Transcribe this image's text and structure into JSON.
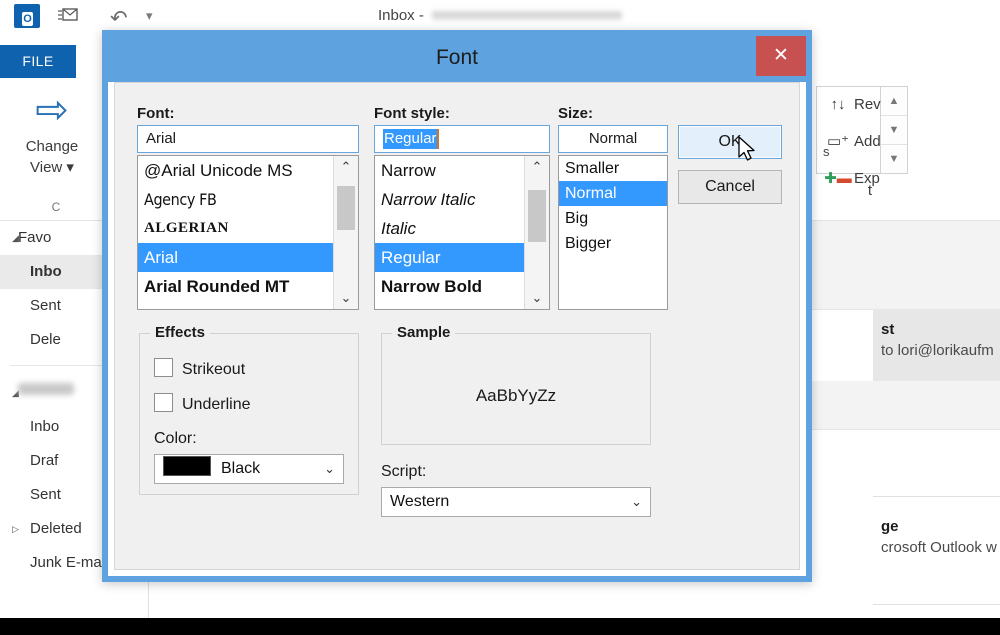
{
  "app": {
    "window_title": "Inbox - ",
    "logo_text": "O",
    "file_tab": "FILE",
    "quick_access": {
      "send_receive_icon": "send-receive-icon",
      "undo_icon": "undo-icon",
      "more_icon": "chevron-down-icon"
    },
    "ribbon": {
      "change_view_label_line1": "Change",
      "change_view_label_line2": "View ▾",
      "group_label": "C",
      "right_items": [
        {
          "icon": "sort-arrows-icon",
          "label": "Rev"
        },
        {
          "icon": "add-columns-icon",
          "label": "Add"
        },
        {
          "icon": "expand-collapse-icon",
          "label": "Exp"
        }
      ],
      "spinner": {
        "up": "▲",
        "down": "▼",
        "bottom": "▼"
      },
      "sort_box_text": "s",
      "loose_text": "t"
    },
    "sidebar": {
      "favorites": {
        "label": "Favo",
        "triangle": "◢"
      },
      "favorite_items": [
        {
          "label": "Inbo",
          "selected": true
        },
        {
          "label": "Sent",
          "selected": false
        },
        {
          "label": "Dele",
          "selected": false
        }
      ],
      "account": {
        "label": "",
        "triangle": "◢",
        "redacted": true
      },
      "account_items": [
        {
          "label": "Inbo",
          "triangle": ""
        },
        {
          "label": "Draf",
          "triangle": ""
        },
        {
          "label": "Sent",
          "triangle": ""
        },
        {
          "label": "Deleted",
          "triangle": "▷"
        },
        {
          "label": "Junk E-mail",
          "triangle": ""
        }
      ]
    },
    "messages": [
      {
        "subject": "st",
        "preview": "to lori@lorikaufm",
        "selected": true
      },
      {
        "subject": "ge",
        "preview": "crosoft Outlook w",
        "selected": false
      }
    ]
  },
  "dialog": {
    "title": "Font",
    "close_label": "✕",
    "font": {
      "label": "Font:",
      "value": "Arial",
      "items": [
        {
          "text": "@Arial Unicode MS",
          "style": "f-unicode",
          "selected": false
        },
        {
          "text": "Agency FB",
          "style": "f-agency",
          "selected": false
        },
        {
          "text": "ALGERIAN",
          "style": "f-algerian",
          "selected": false
        },
        {
          "text": "Arial",
          "style": "f-arial",
          "selected": true
        },
        {
          "text": "Arial Rounded MT",
          "style": "f-arialrnd",
          "selected": false
        }
      ]
    },
    "font_style": {
      "label": "Font style:",
      "value": "Regular",
      "value_selected": true,
      "items": [
        {
          "text": "Narrow",
          "style": "st-narrow",
          "selected": false
        },
        {
          "text": "Narrow Italic",
          "style": "st-narrow st-italic",
          "selected": false
        },
        {
          "text": "Italic",
          "style": "st-italic",
          "selected": false
        },
        {
          "text": "Regular",
          "style": "",
          "selected": true
        },
        {
          "text": "Narrow Bold",
          "style": "st-narrow st-bold",
          "selected": false
        }
      ]
    },
    "size": {
      "label": "Size:",
      "value": "Normal",
      "items": [
        {
          "text": "Smaller",
          "selected": false
        },
        {
          "text": "Normal",
          "selected": true
        },
        {
          "text": "Big",
          "selected": false
        },
        {
          "text": "Bigger",
          "selected": false
        }
      ]
    },
    "buttons": {
      "ok": "OK",
      "cancel": "Cancel"
    },
    "effects": {
      "title": "Effects",
      "strikeout": {
        "label": "Strikeout",
        "checked": false
      },
      "underline": {
        "label": "Underline",
        "checked": false
      },
      "color_label": "Color:",
      "color_value": "Black",
      "color_hex": "#000000",
      "caret": "⌄"
    },
    "sample": {
      "title": "Sample",
      "text": "AaBbYyZz"
    },
    "script": {
      "label": "Script:",
      "value": "Western",
      "caret": "⌄"
    },
    "scrollbars": {
      "up": "⌃",
      "down": "⌄"
    },
    "colors": {
      "titlebar": "#5fa2e0",
      "close_button": "#c75050",
      "selection": "#3399ff",
      "dialog_face": "#f0f0f0"
    }
  }
}
